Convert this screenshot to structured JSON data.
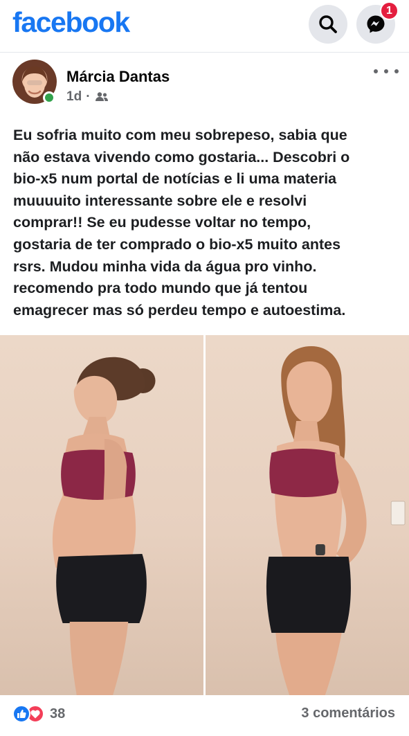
{
  "header": {
    "logo": "facebook",
    "search_icon": "search-icon",
    "messenger_icon": "messenger-icon",
    "messenger_badge": "1"
  },
  "post": {
    "author": "Márcia Dantas",
    "time": "1d",
    "separator": "·",
    "audience_icon": "friends-icon",
    "options_icon": "more-options-icon",
    "text": "Eu sofria muito com meu sobrepeso, sabia que\nnão estava vivendo como gostaria... Descobri o\nbio-x5 num portal de notícias e li uma materia\nmuuuuito interessante sobre ele e resolvi\ncomprar!! Se eu pudesse voltar no tempo,\ngostaria de ter comprado o bio-x5 muito antes\nrsrs. Mudou minha vida da água pro vinho.\nrecomendo pra todo mundo que já tentou\nemagrecer mas só perdeu tempo e autoestima.",
    "reactions": {
      "icons": [
        "like-icon",
        "love-icon"
      ],
      "count": "38"
    },
    "comments": "3 comentários"
  },
  "colors": {
    "brand": "#1877f2",
    "badge": "#e41e3f",
    "online": "#31a24c",
    "love": "#f33e58",
    "secondary_text": "#65676b"
  }
}
